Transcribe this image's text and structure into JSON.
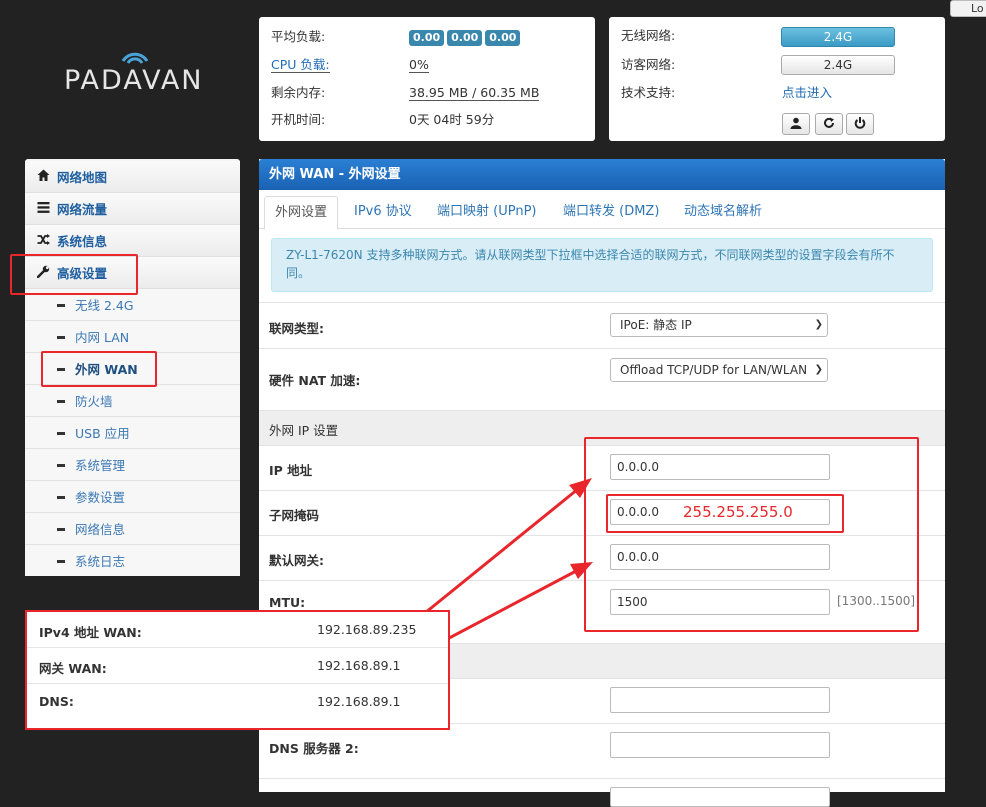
{
  "logo": {
    "text": "PADAVAN"
  },
  "topbar": {
    "logout_label": "Lo"
  },
  "status": {
    "load_label": "平均负载:",
    "load_values": [
      "0.00",
      "0.00",
      "0.00"
    ],
    "cpu_label": "CPU 负载:",
    "cpu_value": "0%",
    "mem_label": "剩余内存:",
    "mem_value": "38.95 MB / 60.35 MB",
    "uptime_label": "开机时间:",
    "uptime_value": "0天 04时 59分"
  },
  "wireless": {
    "wifi_label": "无线网络:",
    "wifi_btn": "2.4G",
    "guest_label": "访客网络:",
    "guest_btn": "2.4G",
    "support_label": "技术支持:",
    "support_link": "点击进入",
    "icons": [
      "user-icon",
      "refresh-icon",
      "power-icon"
    ]
  },
  "sidebar": {
    "main_items": [
      {
        "label": "网络地图",
        "icon": "home-icon"
      },
      {
        "label": "网络流量",
        "icon": "list-icon"
      },
      {
        "label": "系统信息",
        "icon": "shuffle-icon"
      },
      {
        "label": "高级设置",
        "icon": "wrench-icon"
      }
    ],
    "sub_items": [
      {
        "label": "无线 2.4G"
      },
      {
        "label": "内网 LAN"
      },
      {
        "label": "外网 WAN"
      },
      {
        "label": "防火墙"
      },
      {
        "label": "USB 应用"
      },
      {
        "label": "系统管理"
      },
      {
        "label": "参数设置"
      },
      {
        "label": "网络信息"
      },
      {
        "label": "系统日志"
      }
    ]
  },
  "main": {
    "title": "外网 WAN - 外网设置",
    "tabs": [
      "外网设置",
      "IPv6 协议",
      "端口映射 (UPnP)",
      "端口转发 (DMZ)",
      "动态域名解析"
    ],
    "alert": "ZY-L1-7620N 支持多种联网方式。请从联网类型下拉框中选择合适的联网方式，不同联网类型的设置字段会有所不同。",
    "wan_type_label": "联网类型:",
    "wan_type_value": "IPoE: 静态 IP",
    "nat_label": "硬件 NAT 加速:",
    "nat_value": "Offload TCP/UDP for LAN/WLAN",
    "section_ip": "外网 IP 设置",
    "ip_label": "IP 地址",
    "ip_value": "0.0.0.0",
    "mask_label": "子网掩码",
    "mask_value": "0.0.0.0",
    "mask_annotation": "255.255.255.0",
    "gw_label": "默认网关:",
    "gw_value": "0.0.0.0",
    "mtu_label": "MTU:",
    "mtu_value": "1500",
    "mtu_hint": "[1300..1500]",
    "dns2_label": "DNS 服务器 2:",
    "dns1_value": "",
    "dns2_value": ""
  },
  "popup": {
    "rows": [
      {
        "key": "IPv4 地址 WAN:",
        "value": "192.168.89.235"
      },
      {
        "key": "网关 WAN:",
        "value": "192.168.89.1"
      },
      {
        "key": "DNS:",
        "value": "192.168.89.1"
      }
    ]
  },
  "colors": {
    "annotation": "#e8262b",
    "header": "#1a62b3",
    "link": "#1f6cb5"
  }
}
